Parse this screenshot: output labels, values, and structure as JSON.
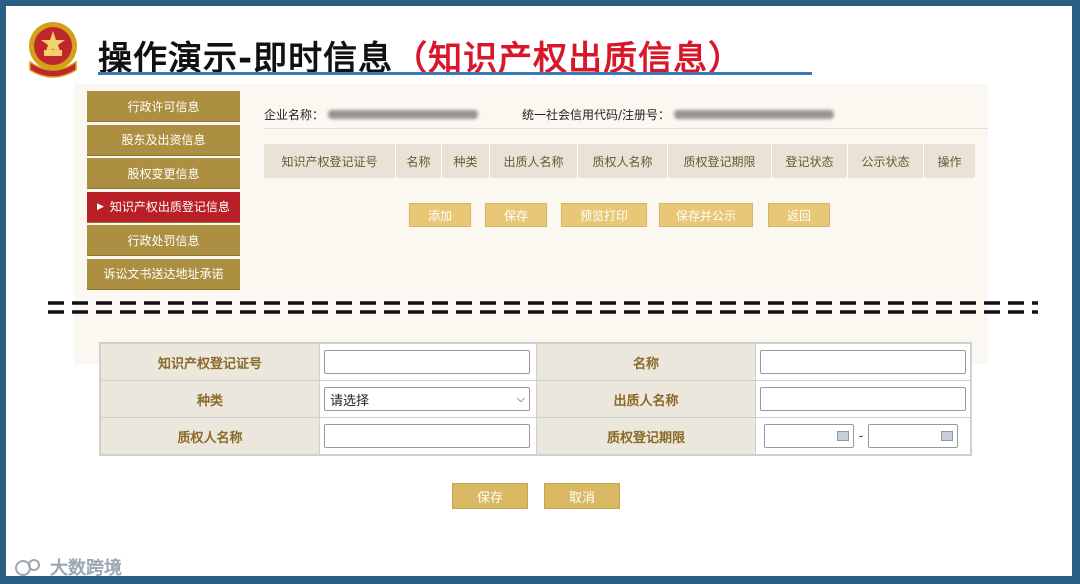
{
  "header": {
    "title_main": "操作演示-即时信息",
    "title_highlight": "（知识产权出质信息）"
  },
  "sidebar": {
    "items": [
      {
        "label": "行政许可信息",
        "active": false
      },
      {
        "label": "股东及出资信息",
        "active": false
      },
      {
        "label": "股权变更信息",
        "active": false
      },
      {
        "label": "知识产权出质登记信息",
        "active": true
      },
      {
        "label": "行政处罚信息",
        "active": false
      },
      {
        "label": "诉讼文书送达地址承诺",
        "active": false
      }
    ]
  },
  "company": {
    "name_label": "企业名称：",
    "code_label": "统一社会信用代码/注册号："
  },
  "table": {
    "columns": [
      "知识产权登记证号",
      "名称",
      "种类",
      "出质人名称",
      "质权人名称",
      "质权登记期限",
      "登记状态",
      "公示状态",
      "操作"
    ]
  },
  "actions": {
    "add": "添加",
    "save": "保存",
    "preview_print": "预览打印",
    "save_publish": "保存并公示",
    "back": "返回"
  },
  "form": {
    "reg_no_label": "知识产权登记证号",
    "name_label": "名称",
    "type_label": "种类",
    "type_value": "请选择",
    "pledgor_label": "出质人名称",
    "pledgee_label": "质权人名称",
    "period_label": "质权登记期限",
    "period_separator": "-"
  },
  "form_actions": {
    "save": "保存",
    "cancel": "取消"
  },
  "watermark": {
    "text": "大数跨境"
  },
  "colors": {
    "sidebar_bg": "#ad8f42",
    "sidebar_active": "#b81f26",
    "button_gold": "#e8c777",
    "title_red": "#d8182a",
    "frame_blue": "#2b5f84"
  }
}
